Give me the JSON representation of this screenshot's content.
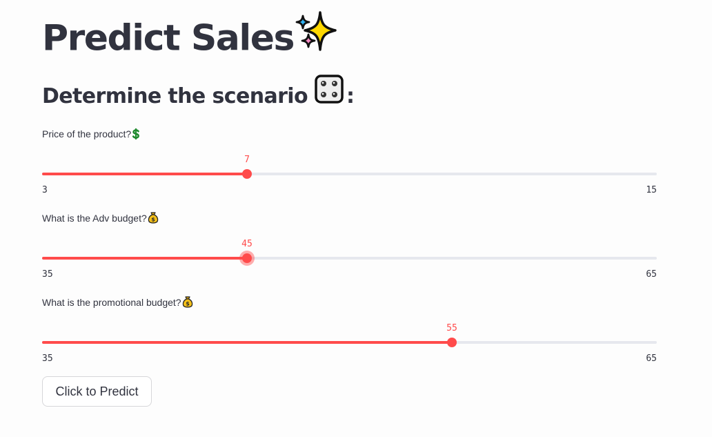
{
  "header": {
    "title": "Predict Sales",
    "title_icon": "sparkles-icon",
    "subtitle": "Determine the scenario",
    "subtitle_icon": "game-die-icon",
    "subtitle_suffix": ":"
  },
  "sliders": [
    {
      "label": "Price of the product?",
      "icon": "heavy-dollar-sign-icon",
      "min": 3,
      "max": 15,
      "value": 7,
      "min_label": "3",
      "max_label": "15",
      "value_label": "7",
      "focused": false
    },
    {
      "label": "What is the Adv budget?",
      "icon": "money-bag-icon",
      "min": 35,
      "max": 65,
      "value": 45,
      "min_label": "35",
      "max_label": "65",
      "value_label": "45",
      "focused": true
    },
    {
      "label": "What is the promotional budget?",
      "icon": "money-bag-icon",
      "min": 35,
      "max": 65,
      "value": 55,
      "min_label": "35",
      "max_label": "65",
      "value_label": "55",
      "focused": false
    }
  ],
  "button": {
    "label": "Click to Predict"
  },
  "colors": {
    "accent": "#ff4b4b",
    "track": "#e6e8ee",
    "text": "#31333f"
  }
}
